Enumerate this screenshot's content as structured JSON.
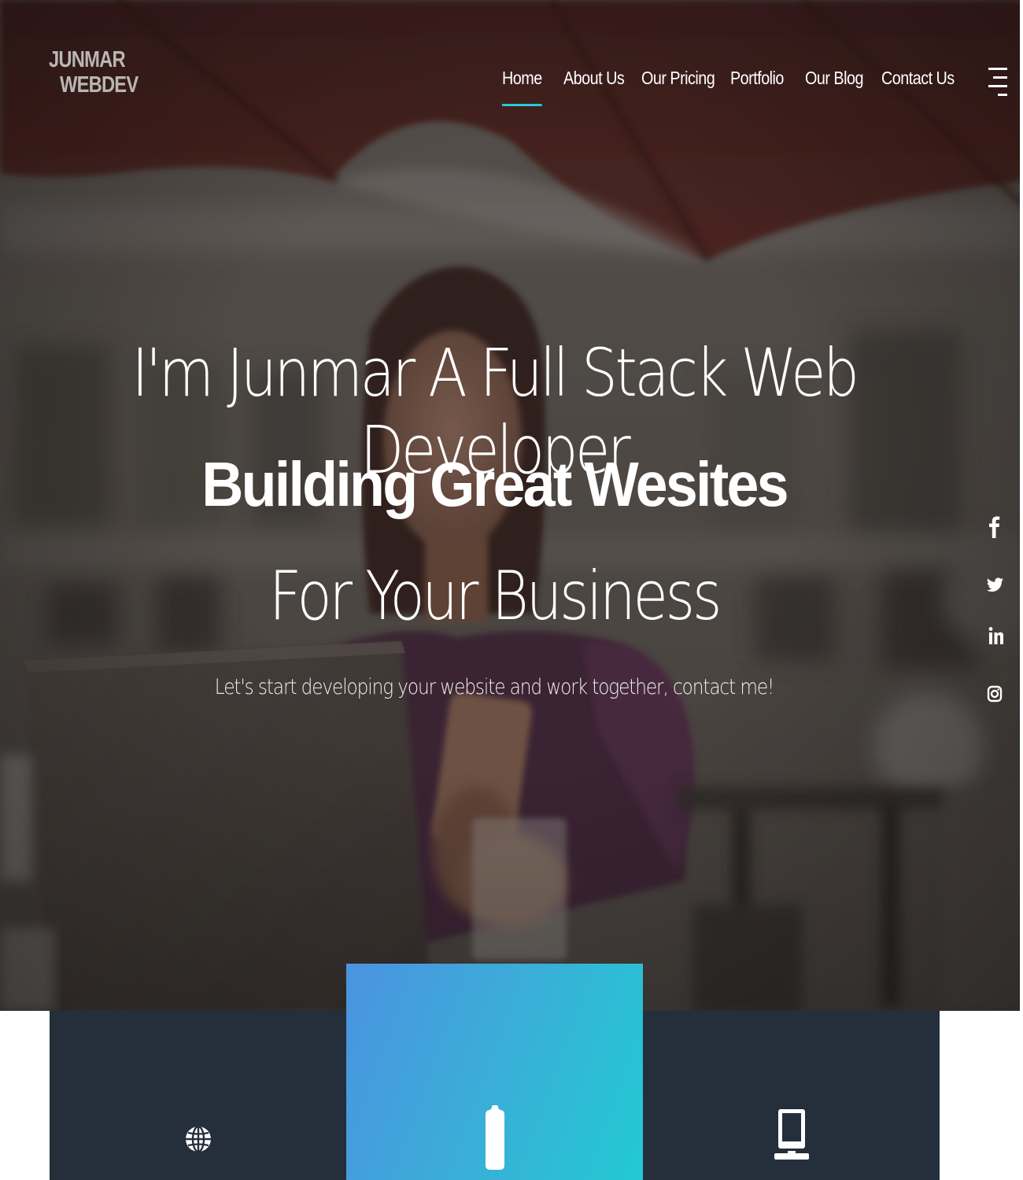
{
  "brand": {
    "line1": "JUNMAR",
    "line2": "WEBDEV"
  },
  "nav": {
    "items": [
      {
        "label": "Home",
        "active": true
      },
      {
        "label": "About Us",
        "active": false
      },
      {
        "label": "Our Pricing",
        "active": false
      },
      {
        "label": "Portfolio",
        "active": false
      },
      {
        "label": "Our Blog",
        "active": false
      },
      {
        "label": "Contact Us",
        "active": false
      }
    ],
    "menu_icon": "hamburger-menu-icon",
    "active_color": "#27c7d6"
  },
  "hero": {
    "headline": "I'm Junmar A Full Stack Web Developer",
    "tagline_bold": "Building Great Wesites",
    "tagline_light": "For Your Business",
    "subtext": "Let's start developing your website and work together, contact me!"
  },
  "social": {
    "icons": [
      "facebook-icon",
      "twitter-icon",
      "linkedin-icon",
      "instagram-icon"
    ]
  },
  "services": {
    "cards": [
      {
        "icon": "globe-icon",
        "background": "#252f3b"
      },
      {
        "icon": "clipboard-icon",
        "background_gradient": [
          "#4b93e0",
          "#22c9d3"
        ]
      },
      {
        "icon": "laptop-icon",
        "background": "#252f3b"
      }
    ]
  }
}
